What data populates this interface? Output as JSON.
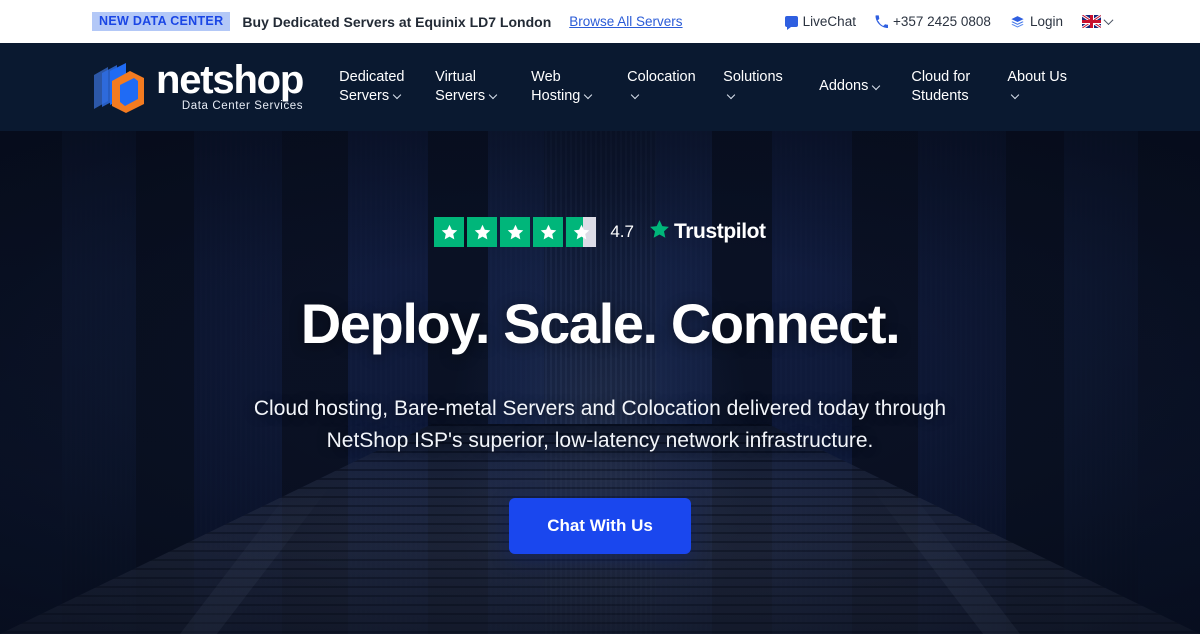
{
  "topbar": {
    "badge": "NEW DATA CENTER",
    "headline": "Buy Dedicated Servers at Equinix LD7 London",
    "link": "Browse All Servers",
    "livechat": "LiveChat",
    "phone": "+357 2425 0808",
    "login": "Login",
    "language": "en-GB",
    "badge_bg": "#b3c8f7",
    "badge_color": "#1a46e5",
    "link_color": "#2a5bd7"
  },
  "header": {
    "logo_word": "netshop",
    "logo_sub": "Data Center Services",
    "bg_color": "#0a1930",
    "nav": [
      {
        "label": "Dedicated Servers",
        "caret": true
      },
      {
        "label": "Virtual Servers",
        "caret": true
      },
      {
        "label": "Web Hosting",
        "caret": true
      },
      {
        "label": "Colocation",
        "caret": true
      },
      {
        "label": "Solutions",
        "caret": true
      },
      {
        "label": "Addons",
        "caret": true
      },
      {
        "label": "Cloud for Students",
        "caret": false
      },
      {
        "label": "About Us",
        "caret": true
      }
    ]
  },
  "hero": {
    "trustpilot": {
      "score": "4.7",
      "brand": "Trustpilot",
      "stars_total": 5,
      "stars_filled": 4,
      "partial_fraction": 0.56,
      "star_color": "#00b67a",
      "empty_color": "#dcdce6"
    },
    "title": "Deploy. Scale. Connect.",
    "subtitle": "Cloud hosting, Bare-metal Servers and Colocation delivered today through NetShop ISP's superior, low-latency network infrastructure.",
    "cta_label": "Chat With Us",
    "cta_color": "#1a47ee"
  }
}
